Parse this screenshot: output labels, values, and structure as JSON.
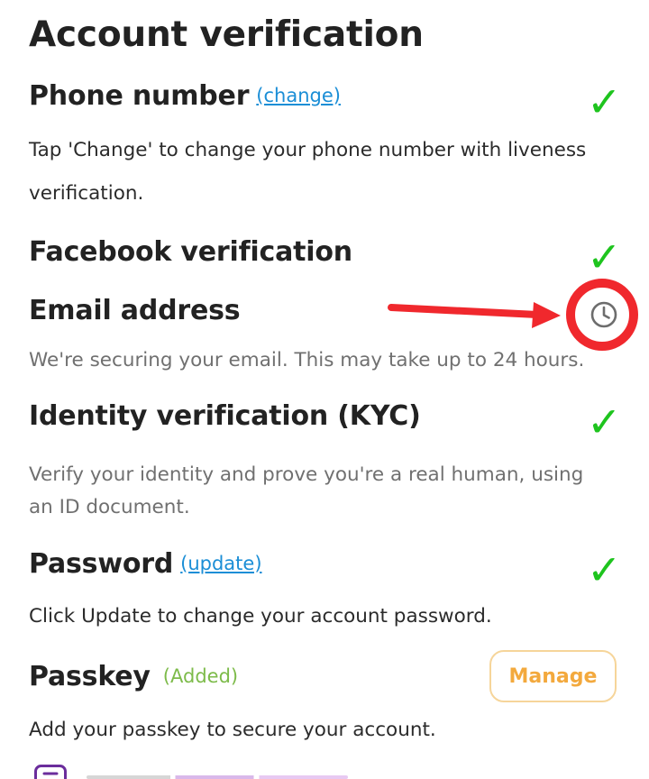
{
  "page": {
    "title": "Account verification"
  },
  "sections": {
    "phone": {
      "title": "Phone number",
      "link": "(change)",
      "description": "Tap 'Change' to change your phone number with liveness verification.",
      "status": "verified"
    },
    "facebook": {
      "title": "Facebook verification",
      "status": "verified"
    },
    "email": {
      "title": "Email address",
      "description": "We're securing your email. This may take up to 24 hours.",
      "status": "pending"
    },
    "identity": {
      "title": "Identity verification (KYC)",
      "description": "Verify your identity and prove you're a real human, using an ID document.",
      "status": "verified"
    },
    "password": {
      "title": "Password",
      "link": "(update)",
      "description": "Click Update to change your account password.",
      "status": "verified"
    },
    "passkey": {
      "title": "Passkey",
      "badge": "(Added)",
      "button": "Manage",
      "description": "Add your passkey to secure your account."
    }
  },
  "icons": {
    "check": "✓",
    "pending": "clock-icon",
    "annotation": "red-arrow-and-circle"
  },
  "colors": {
    "check": "#1ec41e",
    "link": "#1b8ed6",
    "added": "#7dbb4a",
    "manage": "#f3a93d",
    "annotation": "#f0282d"
  }
}
